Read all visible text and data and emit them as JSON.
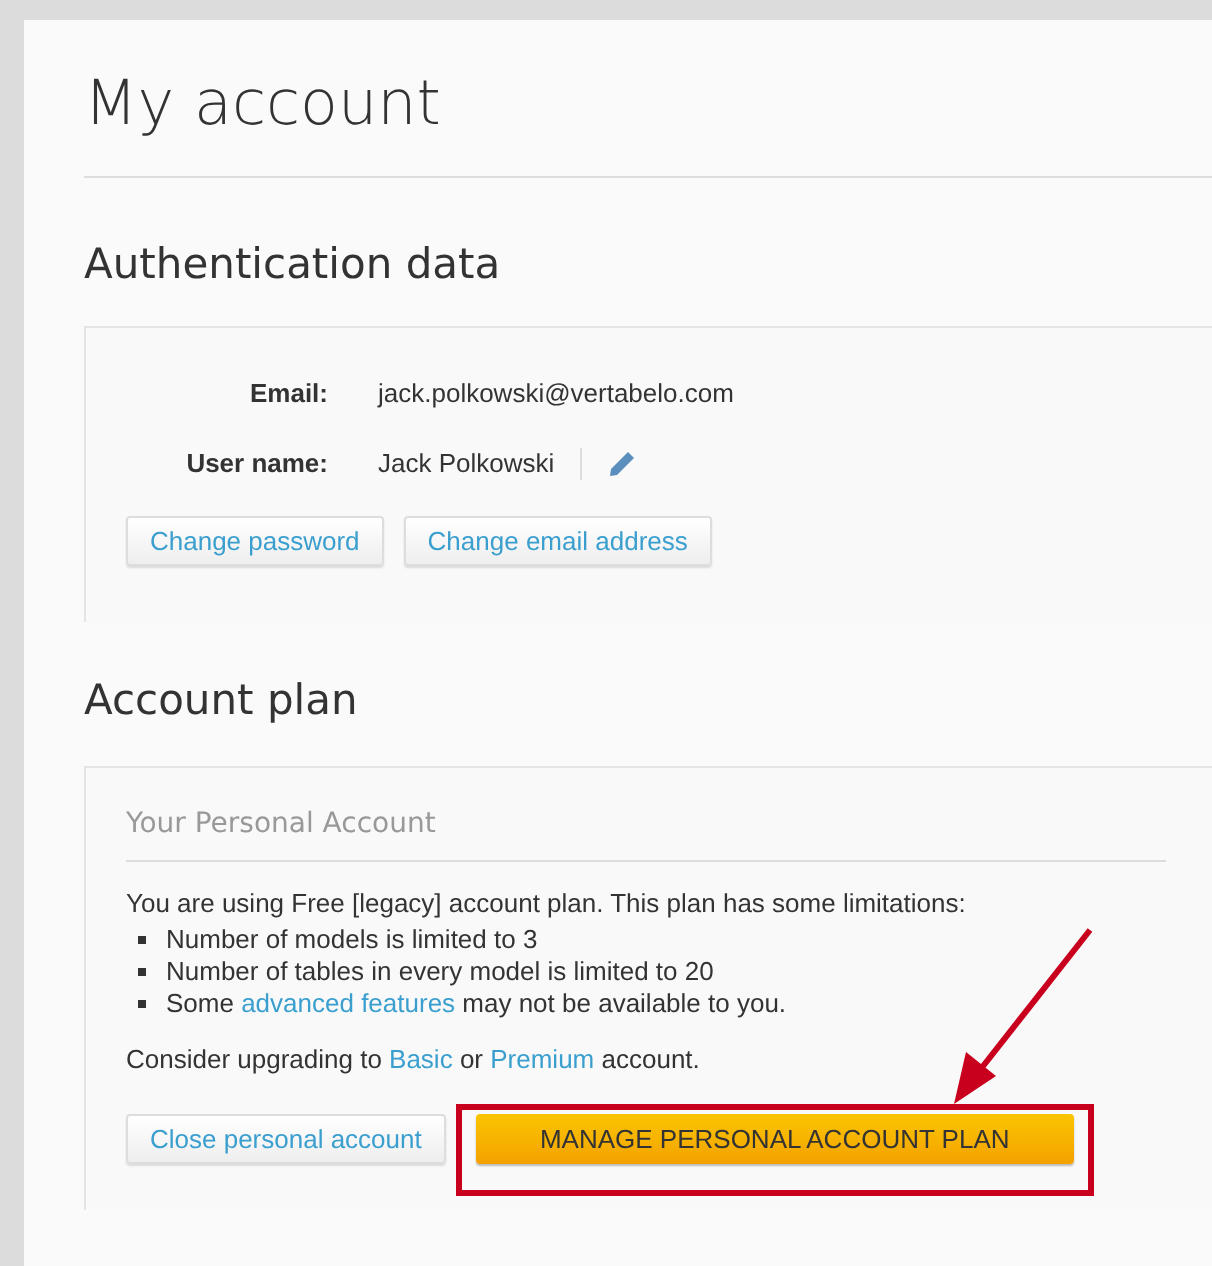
{
  "page_title": "My account",
  "authentication": {
    "heading": "Authentication data",
    "fields": [
      {
        "label": "Email:",
        "value": "jack.polkowski@vertabelo.com",
        "editable": false
      },
      {
        "label": "User name:",
        "value": "Jack Polkowski",
        "editable": true
      }
    ],
    "buttons": [
      "Change password",
      "Change email address"
    ]
  },
  "account_plan": {
    "heading": "Account plan",
    "panel_title": "Your Personal Account",
    "intro": "You are using Free [legacy] account plan. This plan has some limitations:",
    "limitations": [
      [
        {
          "kind": "text",
          "text": "Number of models is limited to 3"
        }
      ],
      [
        {
          "kind": "text",
          "text": "Number of tables in every model is limited to 20"
        }
      ],
      [
        {
          "kind": "text",
          "text": "Some "
        },
        {
          "kind": "link",
          "text": "advanced features"
        },
        {
          "kind": "text",
          "text": " may not be available to you."
        }
      ]
    ],
    "upgrade": [
      {
        "kind": "text",
        "text": "Consider upgrading to "
      },
      {
        "kind": "link",
        "text": "Basic"
      },
      {
        "kind": "text",
        "text": " or "
      },
      {
        "kind": "link",
        "text": "Premium"
      },
      {
        "kind": "text",
        "text": " account."
      }
    ],
    "close_button": "Close personal account",
    "manage_button": "MANAGE PERSONAL ACCOUNT PLAN"
  }
}
